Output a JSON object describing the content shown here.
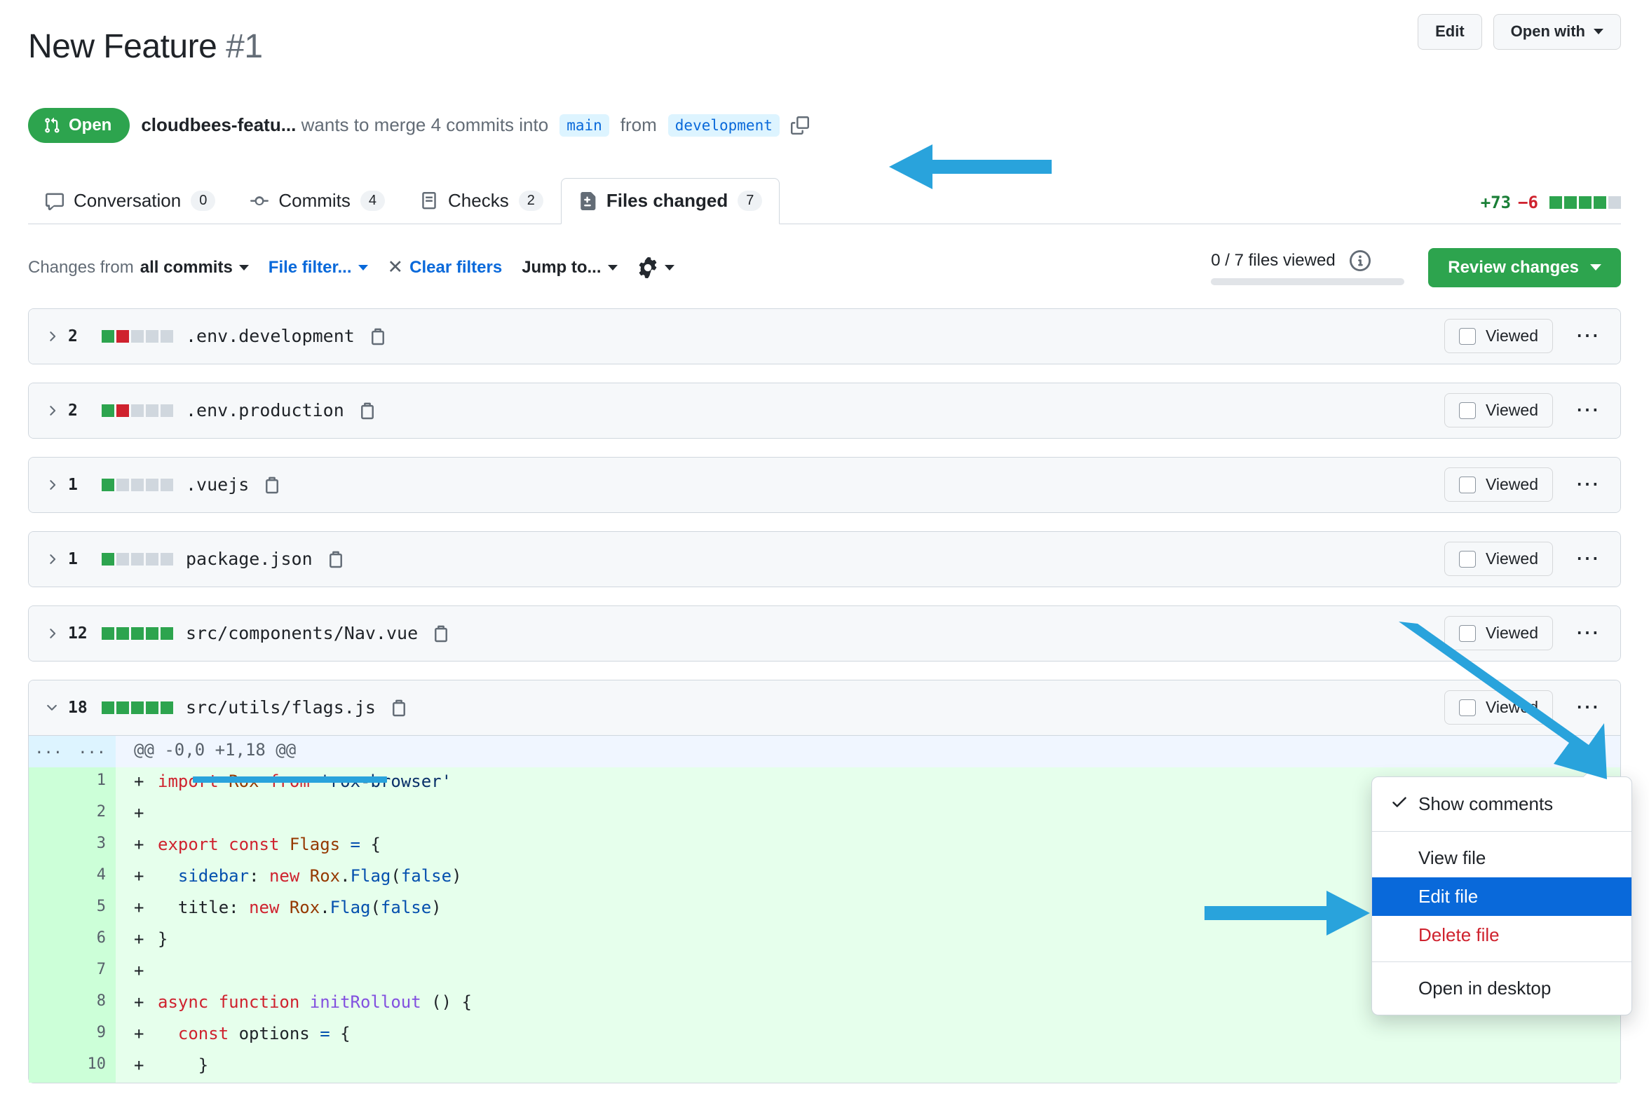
{
  "header": {
    "title": "New Feature",
    "number": "#1",
    "edit_button": "Edit",
    "open_with_button": "Open with",
    "state": "Open",
    "author": "cloudbees-featu...",
    "merge_text_1": "wants to merge 4 commits into",
    "base_branch": "main",
    "merge_text_2": "from",
    "head_branch": "development"
  },
  "tabs": [
    {
      "label": "Conversation",
      "count": "0",
      "icon": "comment-icon",
      "active": false
    },
    {
      "label": "Commits",
      "count": "4",
      "icon": "commit-icon",
      "active": false
    },
    {
      "label": "Checks",
      "count": "2",
      "icon": "checks-icon",
      "active": false
    },
    {
      "label": "Files changed",
      "count": "7",
      "icon": "file-diff-icon",
      "active": true
    }
  ],
  "diffstat": {
    "additions": "+73",
    "deletions": "−6",
    "blocks": [
      "g",
      "g",
      "g",
      "g",
      "n"
    ]
  },
  "filterbar": {
    "changes_from_prefix": "Changes from",
    "changes_from_value": "all commits",
    "file_filter": "File filter...",
    "clear_filters": "Clear filters",
    "jump_to": "Jump to...",
    "files_viewed": "0 / 7 files viewed",
    "review_changes": "Review changes"
  },
  "viewed_label": "Viewed",
  "files": [
    {
      "count": "2",
      "name": ".env.development",
      "blocks": [
        "g",
        "r",
        "n",
        "n",
        "n"
      ],
      "expanded": false
    },
    {
      "count": "2",
      "name": ".env.production",
      "blocks": [
        "g",
        "r",
        "n",
        "n",
        "n"
      ],
      "expanded": false
    },
    {
      "count": "1",
      "name": ".vuejs",
      "blocks": [
        "g",
        "n",
        "n",
        "n",
        "n"
      ],
      "expanded": false
    },
    {
      "count": "1",
      "name": "package.json",
      "blocks": [
        "g",
        "n",
        "n",
        "n",
        "n"
      ],
      "expanded": false
    },
    {
      "count": "12",
      "name": "src/components/Nav.vue",
      "blocks": [
        "g",
        "g",
        "g",
        "g",
        "g"
      ],
      "expanded": false
    },
    {
      "count": "18",
      "name": "src/utils/flags.js",
      "blocks": [
        "g",
        "g",
        "g",
        "g",
        "g"
      ],
      "expanded": true
    }
  ],
  "diff": {
    "hunk_header": "@@ -0,0 +1,18 @@",
    "hunk_gutter": "...",
    "lines": [
      {
        "num": "1",
        "marker": "+",
        "tokens": [
          {
            "t": "import ",
            "c": "k"
          },
          {
            "t": "Rox",
            "c": "v"
          },
          {
            "t": " from ",
            "c": "k"
          },
          {
            "t": "'rox-browser'",
            "c": "s"
          }
        ]
      },
      {
        "num": "2",
        "marker": "+",
        "tokens": []
      },
      {
        "num": "3",
        "marker": "+",
        "tokens": [
          {
            "t": "export const ",
            "c": "k"
          },
          {
            "t": "Flags",
            "c": "v"
          },
          {
            "t": " ",
            "c": "p"
          },
          {
            "t": "=",
            "c": "n"
          },
          {
            "t": " {",
            "c": "p"
          }
        ]
      },
      {
        "num": "4",
        "marker": "+",
        "tokens": [
          {
            "t": "  ",
            "c": "p"
          },
          {
            "t": "sidebar",
            "c": "n"
          },
          {
            "t": ": ",
            "c": "p"
          },
          {
            "t": "new ",
            "c": "k"
          },
          {
            "t": "Rox",
            "c": "v"
          },
          {
            "t": ".",
            "c": "p"
          },
          {
            "t": "Flag",
            "c": "n"
          },
          {
            "t": "(",
            "c": "p"
          },
          {
            "t": "false",
            "c": "n"
          },
          {
            "t": ")",
            "c": "p"
          }
        ]
      },
      {
        "num": "5",
        "marker": "+",
        "tokens": [
          {
            "t": "  title",
            "c": "p"
          },
          {
            "t": ": ",
            "c": "p"
          },
          {
            "t": "new ",
            "c": "k"
          },
          {
            "t": "Rox",
            "c": "v"
          },
          {
            "t": ".",
            "c": "p"
          },
          {
            "t": "Flag",
            "c": "n"
          },
          {
            "t": "(",
            "c": "p"
          },
          {
            "t": "false",
            "c": "n"
          },
          {
            "t": ")",
            "c": "p"
          }
        ]
      },
      {
        "num": "6",
        "marker": "+",
        "tokens": [
          {
            "t": "}",
            "c": "p"
          }
        ]
      },
      {
        "num": "7",
        "marker": "+",
        "tokens": []
      },
      {
        "num": "8",
        "marker": "+",
        "tokens": [
          {
            "t": "async function ",
            "c": "k"
          },
          {
            "t": "initRollout",
            "c": "f"
          },
          {
            "t": " () {",
            "c": "p"
          }
        ]
      },
      {
        "num": "9",
        "marker": "+",
        "tokens": [
          {
            "t": "  ",
            "c": "p"
          },
          {
            "t": "const ",
            "c": "k"
          },
          {
            "t": "options",
            "c": "p"
          },
          {
            "t": " ",
            "c": "p"
          },
          {
            "t": "=",
            "c": "n"
          },
          {
            "t": " {",
            "c": "p"
          }
        ]
      },
      {
        "num": "10",
        "marker": "+",
        "tokens": [
          {
            "t": "    }",
            "c": "p"
          }
        ]
      }
    ]
  },
  "menu": {
    "groups": [
      {
        "items": [
          {
            "label": "Show comments",
            "checked": true,
            "style": "normal"
          }
        ]
      },
      {
        "items": [
          {
            "label": "View file",
            "checked": false,
            "style": "normal"
          },
          {
            "label": "Edit file",
            "checked": false,
            "style": "selected"
          },
          {
            "label": "Delete file",
            "checked": false,
            "style": "danger"
          }
        ]
      },
      {
        "items": [
          {
            "label": "Open in desktop",
            "checked": false,
            "style": "normal"
          }
        ]
      }
    ]
  },
  "annotations": {
    "accent_color": "#29a3dc",
    "arrows": [
      {
        "name": "arrow-to-files-changed-tab",
        "direction": "left"
      },
      {
        "name": "arrow-to-kebab-menu",
        "direction": "down-right"
      },
      {
        "name": "arrow-to-edit-file",
        "direction": "right"
      }
    ],
    "underline": {
      "name": "underline-flags-js"
    }
  }
}
